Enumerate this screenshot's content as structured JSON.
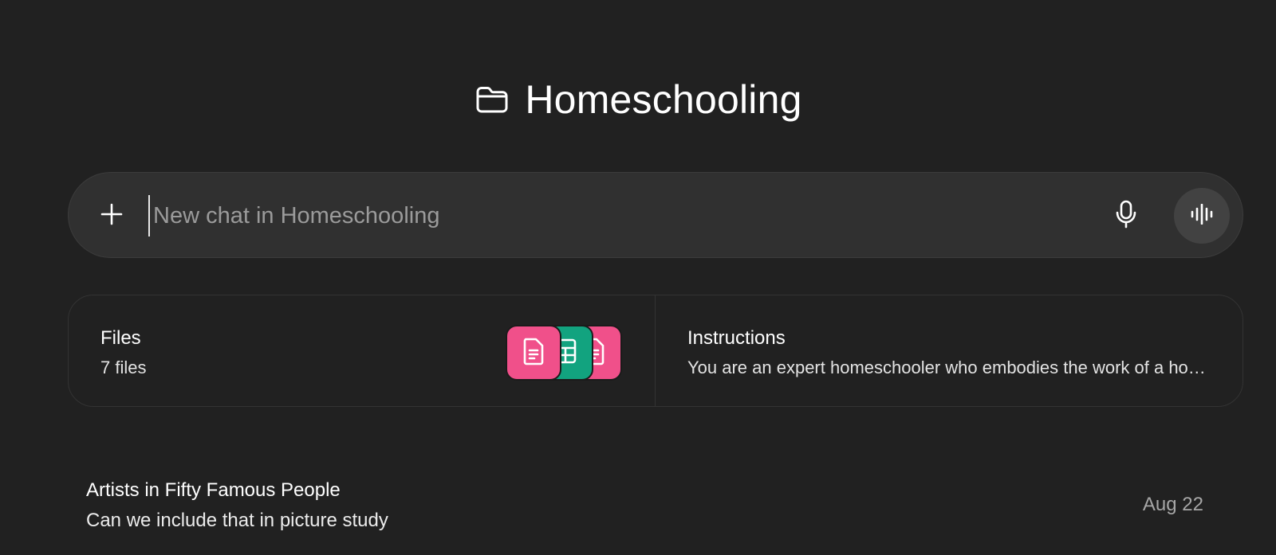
{
  "project": {
    "icon": "folder-icon",
    "title": "Homeschooling"
  },
  "composer": {
    "add_icon": "plus-icon",
    "placeholder": "New chat in Homeschooling",
    "mic_icon": "microphone-icon",
    "voice_icon": "voice-waveform-icon"
  },
  "cards": {
    "files": {
      "title": "Files",
      "subtitle": "7 files",
      "tiles": [
        {
          "icon": "document-icon",
          "color": "#f0508a"
        },
        {
          "icon": "spreadsheet-icon",
          "color": "#12a37f"
        },
        {
          "icon": "document-icon",
          "color": "#f0508a"
        }
      ]
    },
    "instructions": {
      "title": "Instructions",
      "subtitle": "You are an expert homeschooler who embodies the work of a homeschooling pioneer and educator"
    }
  },
  "chats": [
    {
      "title": "Artists in Fifty Famous People",
      "snippet": "Can we include that in picture study",
      "date": "Aug 22"
    }
  ]
}
